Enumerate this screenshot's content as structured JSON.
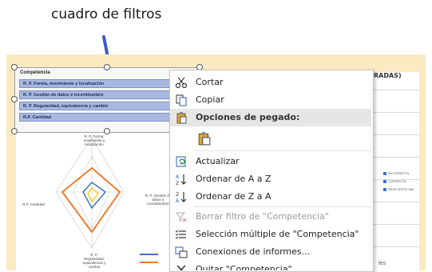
{
  "annotation": {
    "text": "cuadro de filtros"
  },
  "background_chart": {
    "title_fragment": "RADAS)",
    "axis_labels": [
      "R. P. Forma, movimiento y localización",
      "R. P. Gestión de datos e incertidumbre",
      "R. P. Regularidad, equivalencia y cambio",
      "R.P. Cantidad"
    ],
    "legend": [
      {
        "label": "INCORRECTA",
        "color": "#4472c4"
      },
      {
        "label": "CORRECTA",
        "color": "#4472c4"
      },
      {
        "label": "RESPUESTA OMI",
        "color": "#4472c4"
      }
    ],
    "bottom_fragment": "les"
  },
  "slicer": {
    "title": "Competencia",
    "items": [
      "R. P. Forma, movimiento y localización",
      "R. P. Gestión de datos e incertidumbre",
      "R. P. Regularidad, equivalencia y cambio",
      "R.P. Cantidad"
    ]
  },
  "context_menu": {
    "items": [
      {
        "label": "Cortar",
        "icon": "scissors-icon"
      },
      {
        "label": "Copiar",
        "icon": "copy-icon"
      },
      {
        "label": "Opciones de pegado:",
        "icon": "paste-icon"
      },
      {
        "label": "",
        "icon": "paste-option-icon"
      },
      {
        "label": "Actualizar",
        "icon": "refresh-icon"
      },
      {
        "label": "Ordenar de A a Z",
        "icon": "sort-az-icon"
      },
      {
        "label": "Ordenar de Z a A",
        "icon": "sort-za-icon"
      },
      {
        "label": "Borrar filtro de \"Competencia\"",
        "icon": "clear-filter-icon"
      },
      {
        "label": "Selección múltiple de \"Competencia\"",
        "icon": "multiselect-icon"
      },
      {
        "label": "Conexiones de informes...",
        "icon": "report-connections-icon"
      },
      {
        "label": "Quitar \"Competencia\"",
        "icon": "remove-icon"
      }
    ]
  }
}
